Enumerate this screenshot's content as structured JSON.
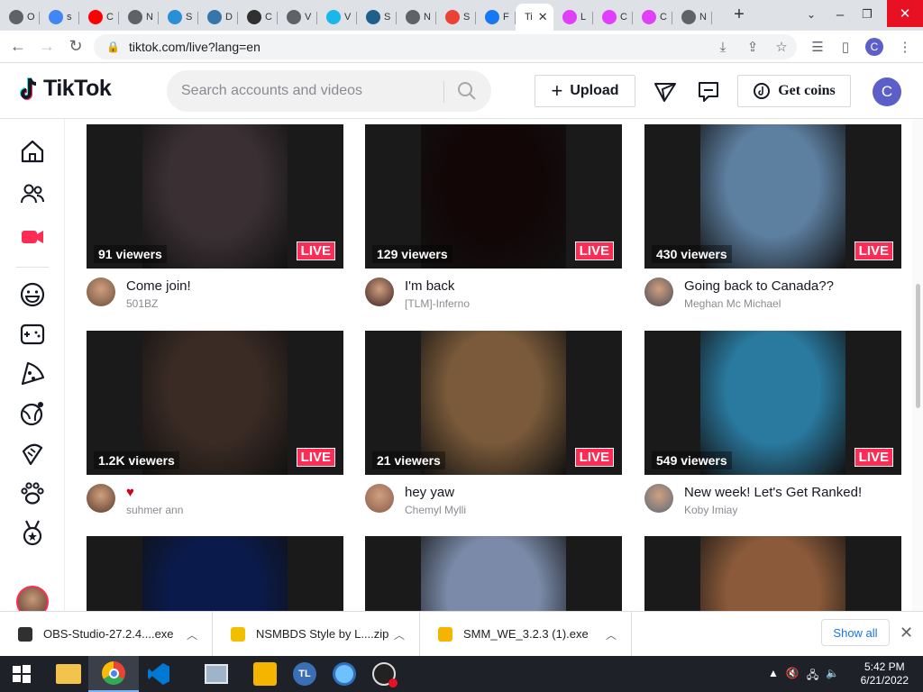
{
  "browser": {
    "tabs": [
      {
        "label": "O",
        "color": "#5f6368"
      },
      {
        "label": "s",
        "color": "#4285f4"
      },
      {
        "label": "C",
        "color": "#ff0000"
      },
      {
        "label": "N",
        "color": "#5f6368"
      },
      {
        "label": "S",
        "color": "#2a8fd6"
      },
      {
        "label": "D",
        "color": "#3776ab"
      },
      {
        "label": "C",
        "color": "#303030"
      },
      {
        "label": "V",
        "color": "#5f6368"
      },
      {
        "label": "V",
        "color": "#1ab7ea"
      },
      {
        "label": "S",
        "color": "#1f5f8b"
      },
      {
        "label": "N",
        "color": "#5f6368"
      },
      {
        "label": "S",
        "color": "#ea4335"
      },
      {
        "label": "F",
        "color": "#1877f2"
      }
    ],
    "active_tab": "Ti",
    "trailing_tabs": [
      {
        "label": "L",
        "color": "#e040fb"
      },
      {
        "label": "C",
        "color": "#e040fb"
      },
      {
        "label": "C",
        "color": "#e040fb"
      },
      {
        "label": "N",
        "color": "#5f6368"
      }
    ],
    "new_tab": "+",
    "url": "tiktok.com/live?lang=en",
    "profile_initial": "C"
  },
  "header": {
    "logo_text": "TikTok",
    "search_placeholder": "Search accounts and videos",
    "upload_label": "Upload",
    "coins_label": "Get coins",
    "avatar_initial": "C"
  },
  "sidebar": {
    "icons": [
      "home-icon",
      "following-icon",
      "live-icon",
      "comedy-icon",
      "gaming-icon",
      "food-icon",
      "travel-icon",
      "beauty-icon",
      "animals-icon",
      "sports-icon"
    ]
  },
  "cards": [
    {
      "viewers": "91 viewers",
      "badge": "LIVE",
      "title": "Come join!",
      "user": "501BZ",
      "thumb": "#3a3033",
      "avatar": "#6b4d3a"
    },
    {
      "viewers": "129 viewers",
      "badge": "LIVE",
      "title": "I'm back",
      "user": "[TLM]-Inferno",
      "thumb": "#120607",
      "avatar": "#3a2020"
    },
    {
      "viewers": "430 viewers",
      "badge": "LIVE",
      "title": "Going back to Canada??",
      "user": "Meghan Mc Michael",
      "thumb": "#5d7fa0",
      "avatar": "#4a4a55"
    },
    {
      "viewers": "1.2K viewers",
      "badge": "LIVE",
      "title": "♥",
      "user": "suhmer ann",
      "thumb": "#3a2b24",
      "avatar": "#5a3a2a"
    },
    {
      "viewers": "21 viewers",
      "badge": "LIVE",
      "title": "hey yaw",
      "user": "Chemyl Mylli",
      "thumb": "#7a5a3a",
      "avatar": "#8a5a4a"
    },
    {
      "viewers": "549 viewers",
      "badge": "LIVE",
      "title": "New week! Let's Get Ranked!",
      "user": "Koby Imiay",
      "thumb": "#2a7aa0",
      "avatar": "#5a6a7a"
    },
    {
      "viewers": "",
      "badge": "",
      "title": "",
      "user": "",
      "thumb": "#0a1a4a",
      "avatar": "#ffffff"
    },
    {
      "viewers": "",
      "badge": "",
      "title": "",
      "user": "",
      "thumb": "#7a8aa8",
      "avatar": "#ffffff"
    },
    {
      "viewers": "",
      "badge": "",
      "title": "",
      "user": "",
      "thumb": "#8a5a3a",
      "avatar": "#ffffff"
    }
  ],
  "downloads": {
    "items": [
      {
        "name": "OBS-Studio-27.2.4....exe",
        "icon_color": "#303030"
      },
      {
        "name": "NSMBDS Style by L....zip",
        "icon_color": "#f0c000"
      },
      {
        "name": "SMM_WE_3.2.3 (1).exe",
        "icon_color": "#f5b400"
      }
    ],
    "show_all": "Show all"
  },
  "taskbar": {
    "time": "5:42 PM",
    "date": "6/21/2022"
  }
}
